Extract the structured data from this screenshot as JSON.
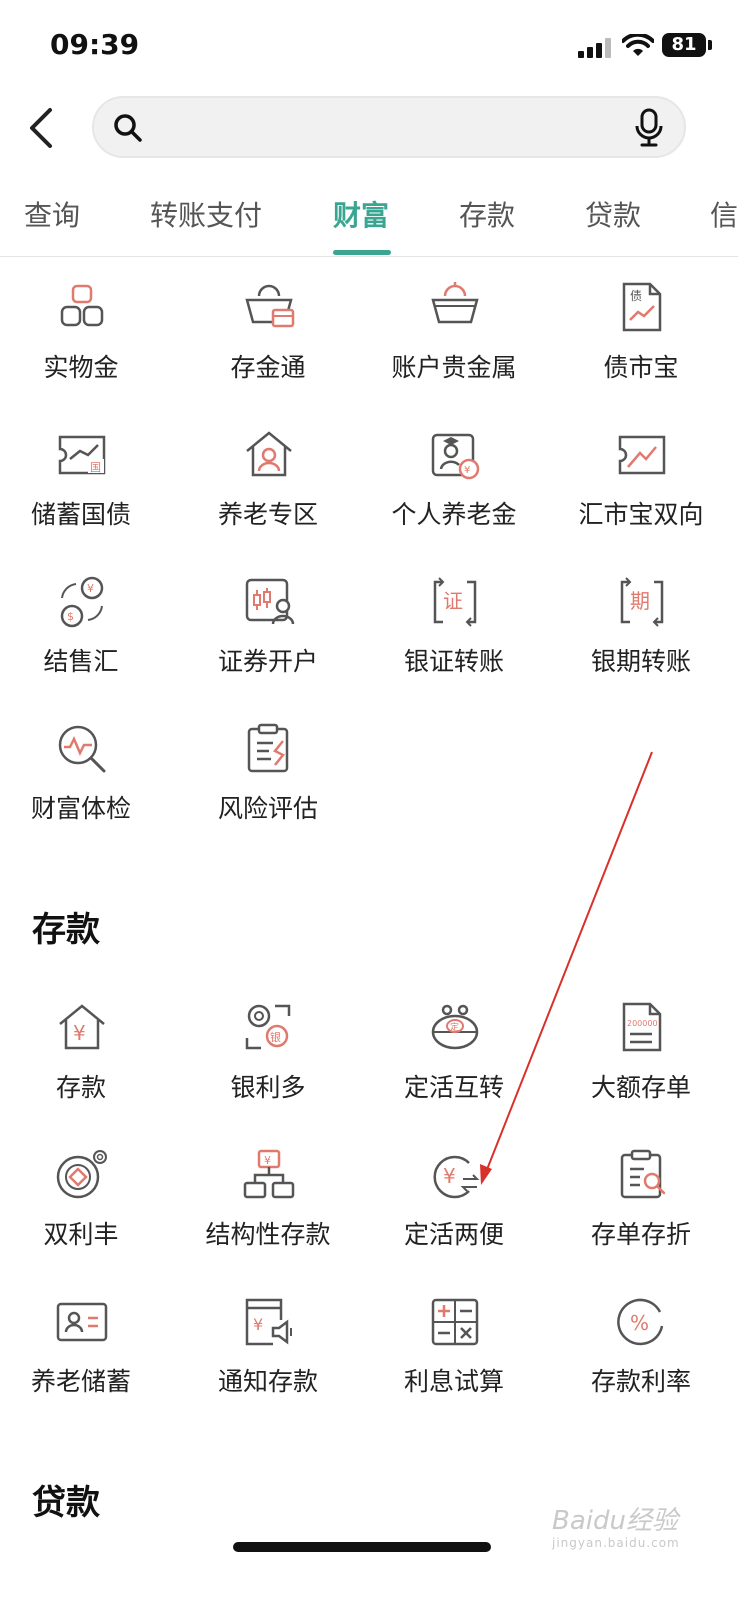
{
  "status_bar": {
    "time": "09:39",
    "battery": "81"
  },
  "search": {
    "placeholder": ""
  },
  "tabs": [
    {
      "label": "查询"
    },
    {
      "label": "转账支付"
    },
    {
      "label": "财富",
      "active": true
    },
    {
      "label": "存款"
    },
    {
      "label": "贷款"
    },
    {
      "label": "信"
    }
  ],
  "wealth": {
    "items": [
      {
        "label": "实物金",
        "icon": "gold-bars-icon"
      },
      {
        "label": "存金通",
        "icon": "gold-savings-icon"
      },
      {
        "label": "账户贵金属",
        "icon": "precious-metal-icon"
      },
      {
        "label": "债市宝",
        "icon": "bond-document-icon"
      },
      {
        "label": "储蓄国债",
        "icon": "savings-bond-icon"
      },
      {
        "label": "养老专区",
        "icon": "pension-house-icon"
      },
      {
        "label": "个人养老金",
        "icon": "personal-pension-icon"
      },
      {
        "label": "汇市宝双向",
        "icon": "forex-chart-icon"
      },
      {
        "label": "结售汇",
        "icon": "currency-exchange-icon"
      },
      {
        "label": "证券开户",
        "icon": "securities-account-icon"
      },
      {
        "label": "银证转账",
        "icon": "bank-securities-transfer-icon"
      },
      {
        "label": "银期转账",
        "icon": "bank-futures-transfer-icon"
      },
      {
        "label": "财富体检",
        "icon": "wealth-checkup-icon"
      },
      {
        "label": "风险评估",
        "icon": "risk-assessment-icon"
      }
    ]
  },
  "deposit": {
    "title": "存款",
    "items": [
      {
        "label": "存款",
        "icon": "deposit-house-icon"
      },
      {
        "label": "银利多",
        "icon": "yinliduo-icon"
      },
      {
        "label": "定活互转",
        "icon": "fixed-current-purse-icon"
      },
      {
        "label": "大额存单",
        "icon": "large-deposit-certificate-icon"
      },
      {
        "label": "双利丰",
        "icon": "shuanglifeng-coin-icon"
      },
      {
        "label": "结构性存款",
        "icon": "structured-deposit-icon"
      },
      {
        "label": "定活两便",
        "icon": "fixed-current-convenient-icon"
      },
      {
        "label": "存单存折",
        "icon": "certificate-passbook-icon"
      },
      {
        "label": "养老储蓄",
        "icon": "pension-savings-icon"
      },
      {
        "label": "通知存款",
        "icon": "notice-deposit-icon"
      },
      {
        "label": "利息试算",
        "icon": "interest-calculator-icon"
      },
      {
        "label": "存款利率",
        "icon": "deposit-rate-icon"
      }
    ]
  },
  "loan": {
    "title": "贷款"
  },
  "watermark": {
    "text": "Baidu经验",
    "sub": "jingyan.baidu.com"
  },
  "colors": {
    "accent": "#3aa692",
    "icon_stroke": "#555555",
    "icon_highlight": "#e07a6e",
    "annotation_arrow": "#d9302a"
  }
}
